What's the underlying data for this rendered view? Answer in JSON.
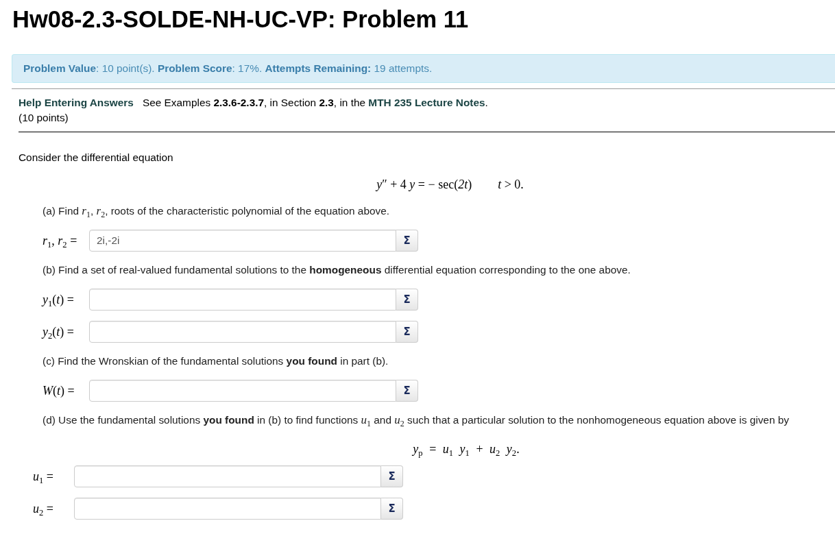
{
  "title": "Hw08-2.3-SOLDE-NH-UC-VP: Problem 11",
  "status": "**Problem Value**: 10 point(s). **Problem Score**: 17%. **Attempts Remaining:** 19 attempts.",
  "help": {
    "link": "Help Entering Answers",
    "sentence_start": "See Examples **2.3.6-2.3.7**, in Section **2.3**, in the ",
    "notes_link": "MTH 235 Lecture Notes",
    "sentence_end": "."
  },
  "points": "(10 points)",
  "intro": "Consider the differential equation",
  "equation": {
    "left": "*y*″ + 4 *y* = − sec(*2t*)",
    "condition": "*t* > 0."
  },
  "parts": [
    {
      "prompt": "(a) Find *r*$_{1}$, *r*$_{2}$, roots of the characteristic polynomial of the equation above.",
      "answers": [
        {
          "label": "*r*$_{1}$, *r*$_{2}$ =",
          "value": "2i,-2i",
          "button": "Σ"
        }
      ]
    },
    {
      "prompt": "(b) Find a set of real-valued fundamental solutions to the **homogeneous** differential equation corresponding to the one above.",
      "answers": [
        {
          "label": "*y*$_{1}$(*t*) =",
          "button": "Σ"
        },
        {
          "label": "*y*$_{2}$(*t*) =",
          "button": "Σ"
        }
      ]
    },
    {
      "prompt": "(c) Find the Wronskian of the fundamental solutions **you found** in part (b).",
      "answers": [
        {
          "label": "*W*(*t*) =",
          "button": "Σ"
        }
      ]
    },
    {
      "prompt": "(d) Use the fundamental solutions **you found** in (b) to find functions *u*$_{1}$ and *u*$_{2}$ such that a particular solution to the nonhomogeneous equation above is given by",
      "equation": "*y*$_{p}$ = *u*$_{1}$ *y*$_{1}$ + *u*$_{2}$ *y*$_{2}$.",
      "answers": [
        {
          "label": "*u*$_{1}$ =",
          "button": "Σ"
        },
        {
          "label": "*u*$_{2}$ =",
          "button": "Σ"
        }
      ]
    }
  ]
}
